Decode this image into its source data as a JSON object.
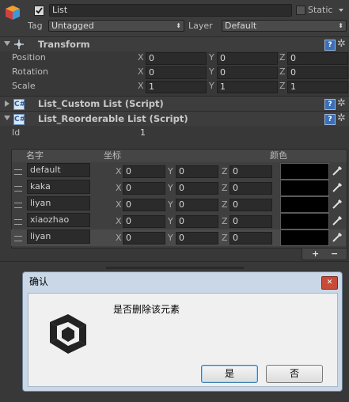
{
  "object": {
    "name": "List",
    "static_label": "Static",
    "tag_label": "Tag",
    "tag_value": "Untagged",
    "layer_label": "Layer",
    "layer_value": "Default"
  },
  "transform": {
    "title": "Transform",
    "rows": [
      {
        "label": "Position",
        "x": "0",
        "y": "0",
        "z": "0"
      },
      {
        "label": "Rotation",
        "x": "0",
        "y": "0",
        "z": "0"
      },
      {
        "label": "Scale",
        "x": "1",
        "y": "1",
        "z": "1"
      }
    ],
    "axis": {
      "x": "X",
      "y": "Y",
      "z": "Z"
    }
  },
  "components": {
    "custom_list": "List_Custom List (Script)",
    "reorderable_list": "List_Reorderable List (Script)"
  },
  "id_field": {
    "label": "Id",
    "value": "1"
  },
  "list": {
    "header_name": "名字",
    "header_coord": "坐标",
    "header_color": "颜色",
    "items": [
      {
        "name": "default",
        "x": "0",
        "y": "0",
        "z": "0"
      },
      {
        "name": "kaka",
        "x": "0",
        "y": "0",
        "z": "0"
      },
      {
        "name": "liyan",
        "x": "0",
        "y": "0",
        "z": "0"
      },
      {
        "name": "xiaozhao",
        "x": "0",
        "y": "0",
        "z": "0"
      },
      {
        "name": "liyan",
        "x": "0",
        "y": "0",
        "z": "0"
      }
    ],
    "add_label": "+",
    "remove_label": "−"
  },
  "dialog": {
    "title": "确认",
    "message": "是否删除该元素",
    "yes_label": "是",
    "no_label": "否",
    "close_label": "✕"
  },
  "colors": {
    "swatch": "#000000",
    "dialog_close": "#c94a36",
    "accent": "#3b6fb8"
  }
}
